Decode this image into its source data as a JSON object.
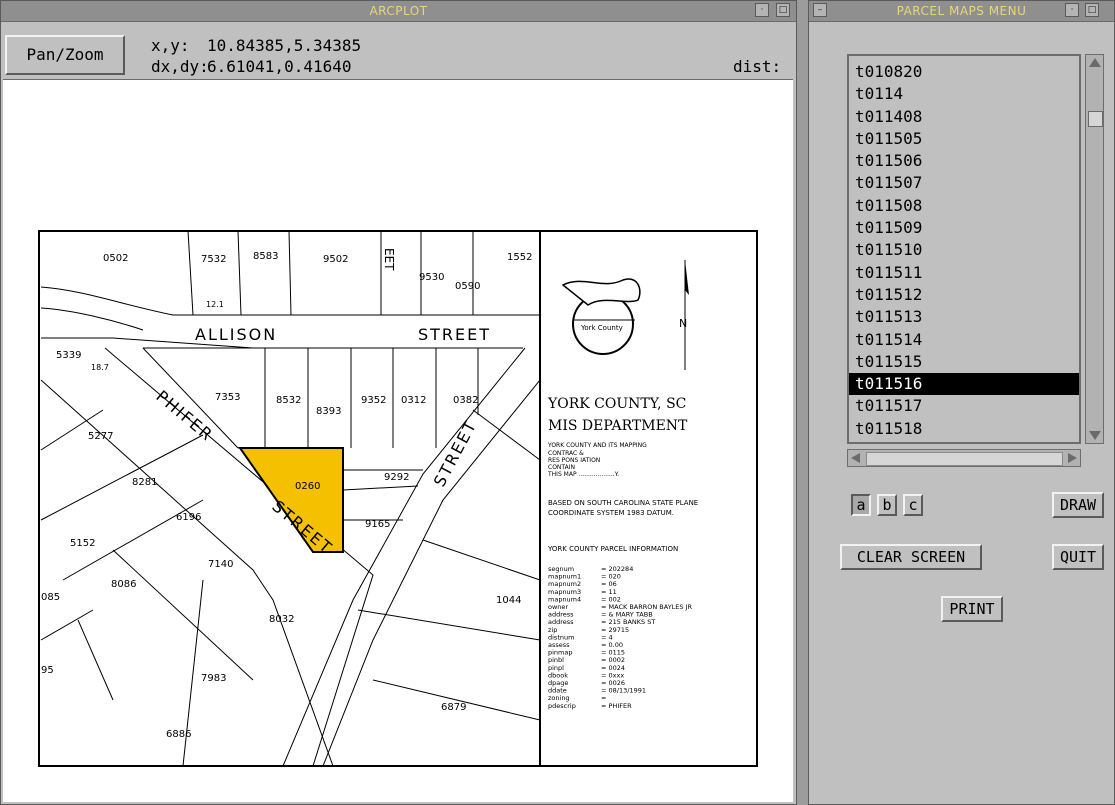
{
  "arcplot": {
    "title": "ARCPLOT",
    "pan_zoom_label": "Pan/Zoom",
    "xy_label": "x,y:",
    "xy_value": "10.84385,5.34385",
    "dxdy_label": "dx,dy:",
    "dxdy_value": "6.61041,0.41640",
    "dist_label": "dist:"
  },
  "map": {
    "street_allison": "ALLISON",
    "street_street_top": "STREET",
    "street_phifer": "PHIFER",
    "street_street_diag": "STREET",
    "street_street_right": "STREET",
    "street_eet": "EET",
    "parcels": [
      "0502",
      "7532",
      "8583",
      "9502",
      "9530",
      "0590",
      "1552",
      "5339",
      "7353",
      "8532",
      "8393",
      "9352",
      "0312",
      "0382",
      "5277",
      "0260",
      "9292",
      "8281",
      "6196",
      "9165",
      "5152",
      "7140",
      "8086",
      "8032",
      "1044",
      "7983",
      "6879",
      "6886",
      "085",
      "95",
      "12.1",
      "18.7"
    ],
    "legend": {
      "county": "YORK COUNTY, SC",
      "dept": "MIS DEPARTMENT",
      "disclaimer": [
        "YORK COUNTY AND ITS MAPPING",
        "CONTRAC                    &",
        "RES PONS                      IATION",
        "CONTAIN",
        "THIS MAP ...................Y."
      ],
      "datum": [
        "BASED ON SOUTH CAROLINA STATE PLANE",
        "COORDINATE SYSTEM 1983 DATUM."
      ],
      "info_title": "YORK COUNTY PARCEL INFORMATION",
      "fields": [
        [
          "segnum",
          "= 202284"
        ],
        [
          "mapnum1",
          "= 020"
        ],
        [
          "mapnum2",
          "= 06"
        ],
        [
          "mapnum3",
          "= 11"
        ],
        [
          "mapnum4",
          "= 002"
        ],
        [
          "owner",
          "= MACK BARRON BAYLES JR"
        ],
        [
          "address",
          "= & MARY TABB"
        ],
        [
          "address",
          "= 215 BANKS ST"
        ],
        [
          "zip",
          "=  29715"
        ],
        [
          "distnum",
          "= 4"
        ],
        [
          "assess",
          "=    0.00"
        ],
        [
          "pinmap",
          "= 0115"
        ],
        [
          "pinbl",
          "= 0002"
        ],
        [
          "pinpl",
          "= 0024"
        ],
        [
          "dbook",
          "= 0xxx"
        ],
        [
          "dpage",
          "= 0026"
        ],
        [
          "ddate",
          "= 08/13/1991"
        ],
        [
          "zoning",
          "="
        ],
        [
          "pdescrip",
          "= PHIFER"
        ]
      ]
    }
  },
  "menu": {
    "title": "PARCEL MAPS MENU",
    "items": [
      "t010820",
      "t0114",
      "t011408",
      "t011505",
      "t011506",
      "t011507",
      "t011508",
      "t011509",
      "t011510",
      "t011511",
      "t011512",
      "t011513",
      "t011514",
      "t011515",
      "t011516",
      "t011517",
      "t011518"
    ],
    "selected": "t011516",
    "toggles": [
      "a",
      "b",
      "c"
    ],
    "draw_label": "DRAW",
    "clear_label": "CLEAR SCREEN",
    "quit_label": "QUIT",
    "print_label": "PRINT"
  },
  "colors": {
    "selected_parcel": "#f5c000",
    "title_text": "#e8d67a"
  }
}
